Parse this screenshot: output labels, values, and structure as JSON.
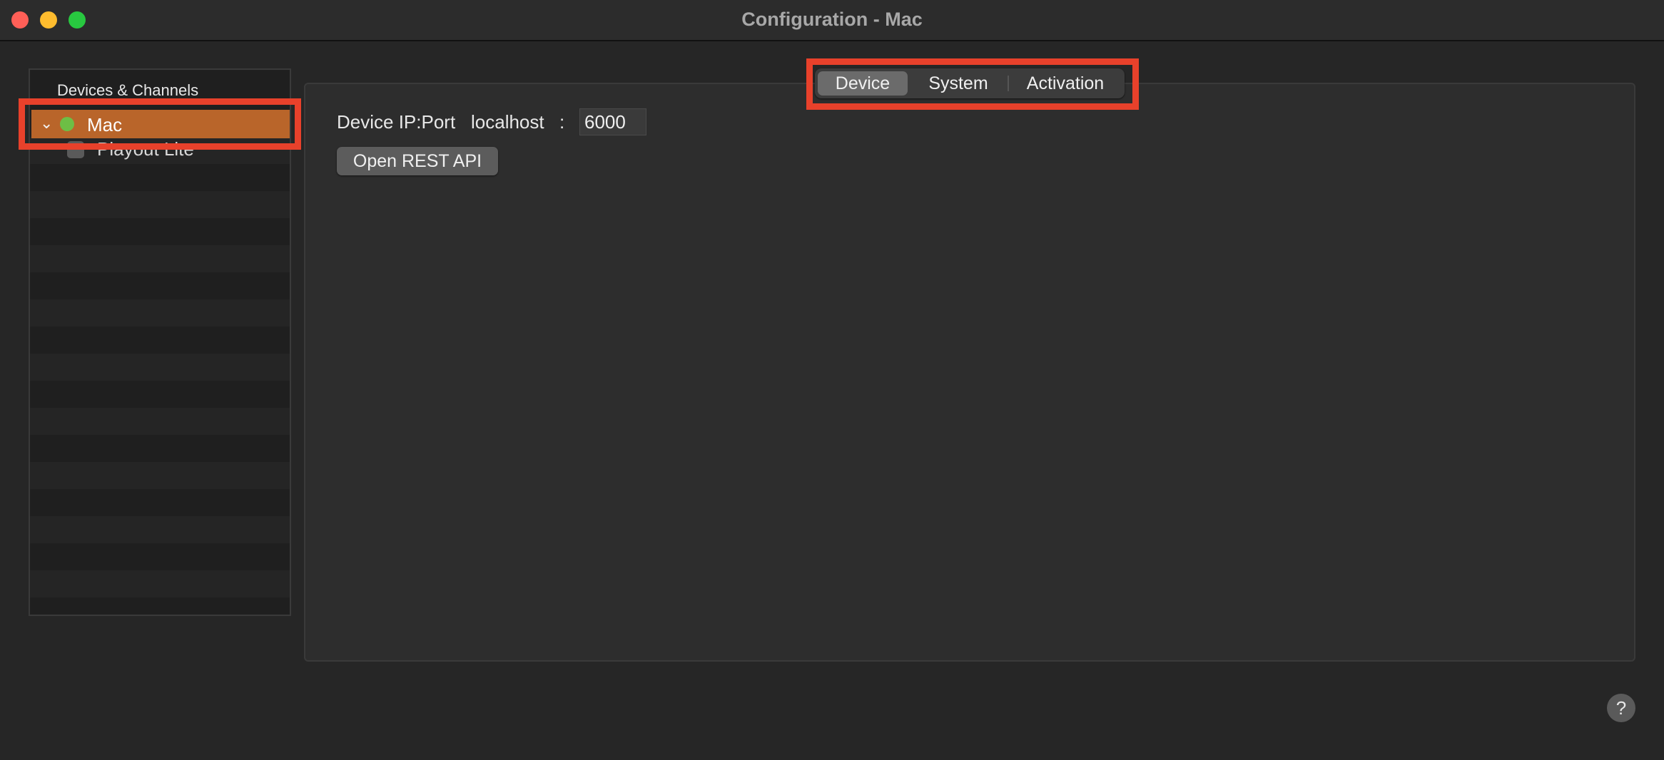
{
  "window": {
    "title": "Configuration - Mac"
  },
  "sidebar": {
    "header": "Devices & Channels",
    "items": [
      {
        "label": "Mac",
        "status": "online",
        "status_color": "#6dbe45",
        "expanded": true,
        "selected": true
      },
      {
        "label": "Playout Lite",
        "checked": false
      }
    ]
  },
  "tabs": [
    {
      "label": "Device",
      "selected": true
    },
    {
      "label": "System",
      "selected": false
    },
    {
      "label": "Activation",
      "selected": false
    }
  ],
  "device": {
    "ip_port_label": "Device IP:Port",
    "host": "localhost",
    "separator": ":",
    "port": "6000",
    "rest_button": "Open REST API"
  },
  "help": {
    "label": "?"
  },
  "colors": {
    "selection": "#b9652a",
    "highlight": "#e8412b",
    "background": "#262626"
  }
}
